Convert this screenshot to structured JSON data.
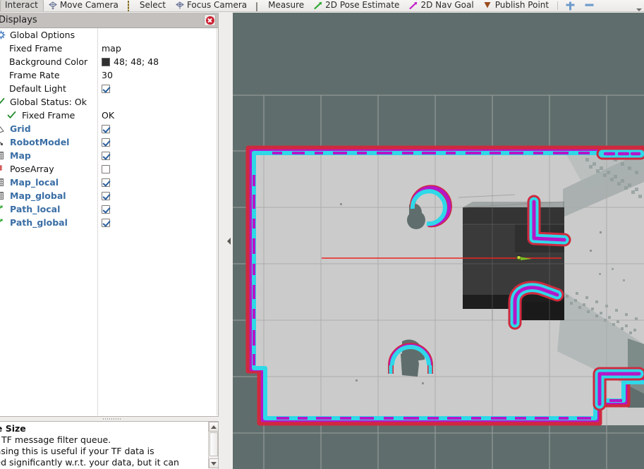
{
  "toolbar": {
    "tools": [
      {
        "label": "Interact",
        "icon": "hand-icon",
        "active": true
      },
      {
        "label": "Move Camera",
        "icon": "move-camera-icon",
        "active": false
      },
      {
        "label": "Select",
        "icon": "select-icon",
        "active": false
      },
      {
        "label": "Focus Camera",
        "icon": "focus-camera-icon",
        "active": false
      },
      {
        "label": "Measure",
        "icon": "measure-icon",
        "active": false
      },
      {
        "label": "2D Pose Estimate",
        "icon": "pose-estimate-arrow-icon",
        "active": false
      },
      {
        "label": "2D Nav Goal",
        "icon": "nav-goal-arrow-icon",
        "active": false
      },
      {
        "label": "Publish Point",
        "icon": "publish-point-icon",
        "active": false
      }
    ],
    "add_tool_icon": "plus-icon",
    "remove_tool_icon": "minus-icon",
    "overflow_icon": "chevron-down-icon"
  },
  "displays": {
    "title": "Displays",
    "close_icon": "close-icon",
    "rows": [
      {
        "name": "Global Options",
        "icon": "gear-icon",
        "value_type": "none",
        "value": "",
        "style": "plain",
        "indent": 0
      },
      {
        "name": "Fixed Frame",
        "icon": "none",
        "value_type": "text",
        "value": "map",
        "style": "plain",
        "indent": 1
      },
      {
        "name": "Background Color",
        "icon": "none",
        "value_type": "color",
        "value": "48; 48; 48",
        "color": "#303030",
        "style": "plain",
        "indent": 1
      },
      {
        "name": "Frame Rate",
        "icon": "none",
        "value_type": "text",
        "value": "30",
        "style": "plain",
        "indent": 1
      },
      {
        "name": "Default Light",
        "icon": "none",
        "value_type": "checkbox",
        "checked": true,
        "value": "",
        "style": "plain",
        "indent": 1
      },
      {
        "name": "Global Status: Ok",
        "icon": "status-ok-check-icon",
        "value_type": "none",
        "value": "",
        "style": "plain",
        "indent": 0
      },
      {
        "name": "Fixed Frame",
        "icon": "status-ok-check-icon",
        "value_type": "text",
        "value": "OK",
        "style": "plain",
        "indent": 1
      },
      {
        "name": "Grid",
        "icon": "grid-icon",
        "value_type": "checkbox",
        "checked": true,
        "value": "",
        "style": "blue",
        "indent": 0
      },
      {
        "name": "RobotModel",
        "icon": "robot-model-icon",
        "value_type": "checkbox",
        "checked": true,
        "value": "",
        "style": "blue",
        "indent": 0
      },
      {
        "name": "Map",
        "icon": "map-icon",
        "value_type": "checkbox",
        "checked": true,
        "value": "",
        "style": "blue",
        "indent": 0
      },
      {
        "name": "PoseArray",
        "icon": "pose-array-icon",
        "value_type": "checkbox",
        "checked": false,
        "value": "",
        "style": "plain",
        "indent": 0
      },
      {
        "name": "Map_local",
        "icon": "map-icon",
        "value_type": "checkbox",
        "checked": true,
        "value": "",
        "style": "blue",
        "indent": 0
      },
      {
        "name": "Map_global",
        "icon": "map-icon",
        "value_type": "checkbox",
        "checked": true,
        "value": "",
        "style": "blue",
        "indent": 0
      },
      {
        "name": "Path_local",
        "icon": "path-icon",
        "value_type": "checkbox",
        "checked": true,
        "value": "",
        "style": "blue",
        "indent": 0
      },
      {
        "name": "Path_global",
        "icon": "path-icon",
        "value_type": "checkbox",
        "checked": true,
        "value": "",
        "style": "blue",
        "indent": 0
      }
    ]
  },
  "help": {
    "heading": "ue Size",
    "line1": " of TF message filter queue.",
    "line2": "easing this is useful if your TF data is",
    "line3": "ved significantly w.r.t. your data, but it can",
    "scroll_up_icon": "scroll-up-arrow-icon",
    "scroll_down_icon": "scroll-down-arrow-icon"
  },
  "view3d": {
    "background_color": "#5f6e6c",
    "map_free_color": "#cbcbcb",
    "grid_line_color": "#a9aaa8",
    "local_costmap_color": "#3a3a3a",
    "costmap_red": "#d0293f",
    "costmap_magenta": "#b616c8",
    "costmap_cyan": "#2fd8e8",
    "path_line_color": "#ee2222",
    "robot_color": "#88c020",
    "collapse_icon": "collapse-left-arrow-icon"
  }
}
